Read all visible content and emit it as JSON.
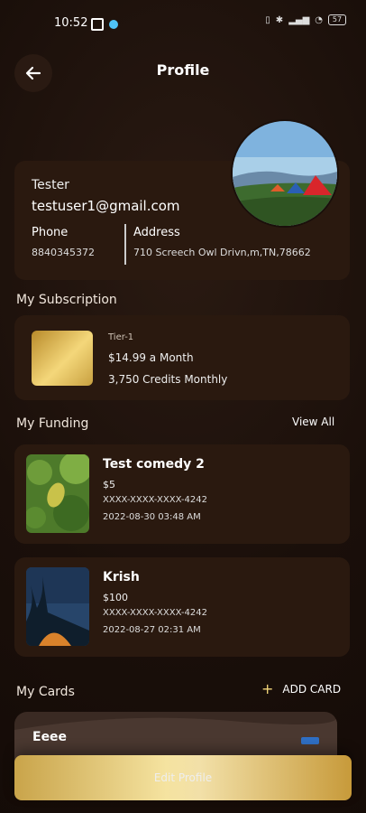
{
  "status_bar": {
    "time": "10:52",
    "battery": "57"
  },
  "header": {
    "title": "Profile"
  },
  "profile": {
    "name": "Tester",
    "email": "testuser1@gmail.com",
    "phone_label": "Phone",
    "phone_value": "8840345372",
    "address_label": "Address",
    "address_value": "710 Screech Owl Drivn,m,TN,78662"
  },
  "subscription": {
    "section_title": "My Subscription",
    "tier": "Tier-1",
    "price": "$14.99 a Month",
    "credits": "3,750 Credits Monthly"
  },
  "funding": {
    "section_title": "My Funding",
    "view_all": "View All",
    "items": [
      {
        "title": "Test comedy 2",
        "amount": "$5",
        "card": "XXXX-XXXX-XXXX-4242",
        "date": "2022-08-30 03:48 AM"
      },
      {
        "title": "Krish",
        "amount": "$100",
        "card": "XXXX-XXXX-XXXX-4242",
        "date": "2022-08-27 02:31 AM"
      }
    ]
  },
  "cards": {
    "section_title": "My Cards",
    "add_label": "ADD CARD",
    "items": [
      {
        "name": "Eeee"
      }
    ]
  },
  "edit_button": "Edit Profile",
  "colors": {
    "background": "#1a0f0a",
    "panel": "#2a190f",
    "gold": "#f4d77a"
  }
}
